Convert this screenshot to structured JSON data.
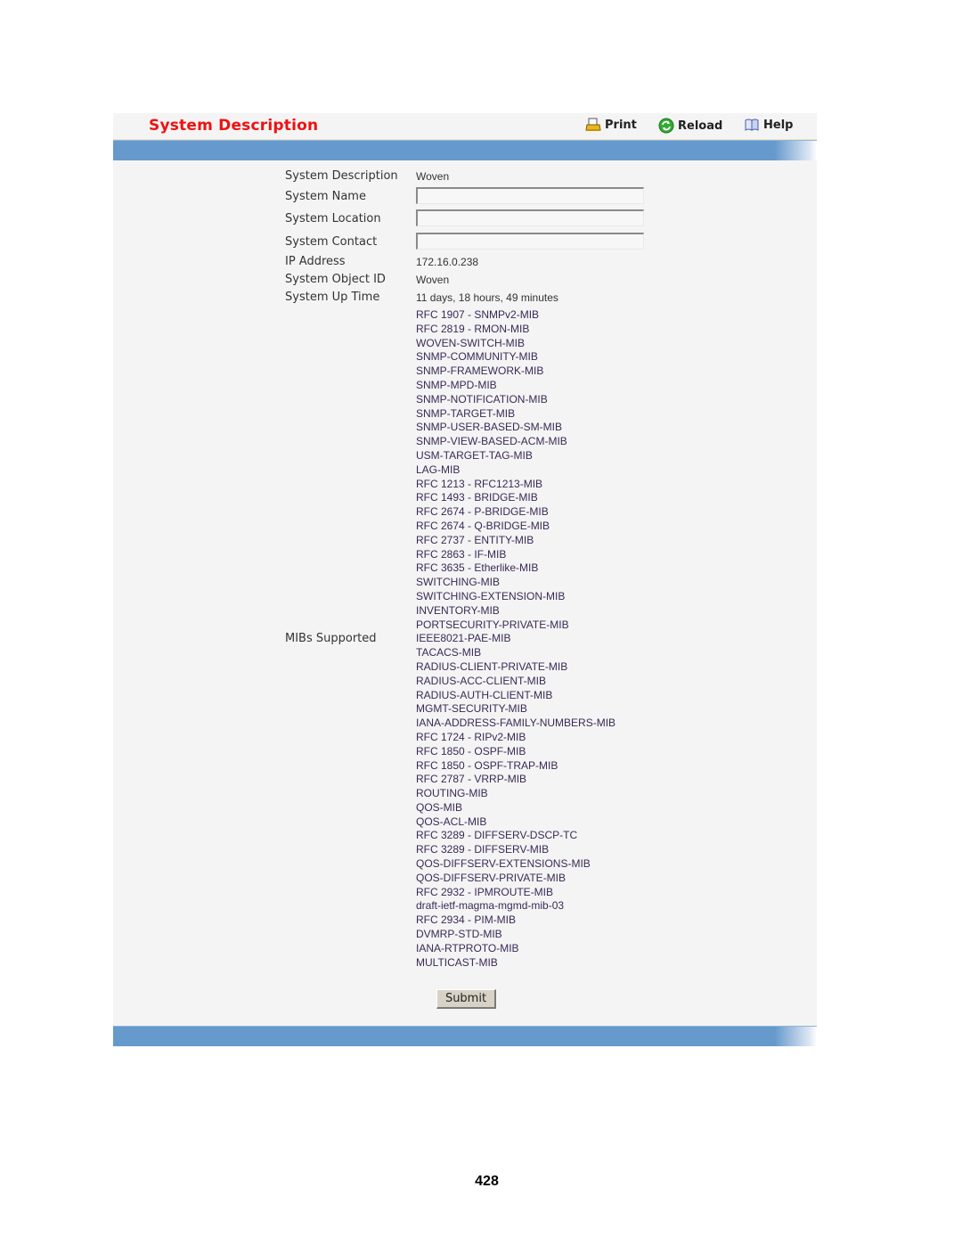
{
  "header": {
    "title": "System Description",
    "toolbar": {
      "print_label": "Print",
      "reload_label": "Reload",
      "help_label": "Help"
    }
  },
  "fields": {
    "system_description": {
      "label": "System Description",
      "value": "Woven"
    },
    "system_name": {
      "label": "System Name",
      "value": ""
    },
    "system_location": {
      "label": "System Location",
      "value": ""
    },
    "system_contact": {
      "label": "System Contact",
      "value": ""
    },
    "ip_address": {
      "label": "IP Address",
      "value": "172.16.0.238"
    },
    "system_object_id": {
      "label": "System Object ID",
      "value": "Woven"
    },
    "system_up_time": {
      "label": "System Up Time",
      "value": "11 days, 18 hours, 49 minutes"
    }
  },
  "mibs": {
    "label": "MIBs Supported",
    "items": [
      "RFC 1907 - SNMPv2-MIB",
      "RFC 2819 - RMON-MIB",
      "WOVEN-SWITCH-MIB",
      "SNMP-COMMUNITY-MIB",
      "SNMP-FRAMEWORK-MIB",
      "SNMP-MPD-MIB",
      "SNMP-NOTIFICATION-MIB",
      "SNMP-TARGET-MIB",
      "SNMP-USER-BASED-SM-MIB",
      "SNMP-VIEW-BASED-ACM-MIB",
      "USM-TARGET-TAG-MIB",
      "LAG-MIB",
      "RFC 1213 - RFC1213-MIB",
      "RFC 1493 - BRIDGE-MIB",
      "RFC 2674 - P-BRIDGE-MIB",
      "RFC 2674 - Q-BRIDGE-MIB",
      "RFC 2737 - ENTITY-MIB",
      "RFC 2863 - IF-MIB",
      "RFC 3635 - Etherlike-MIB",
      "SWITCHING-MIB",
      "SWITCHING-EXTENSION-MIB",
      "INVENTORY-MIB",
      "PORTSECURITY-PRIVATE-MIB",
      "IEEE8021-PAE-MIB",
      "TACACS-MIB",
      "RADIUS-CLIENT-PRIVATE-MIB",
      "RADIUS-ACC-CLIENT-MIB",
      "RADIUS-AUTH-CLIENT-MIB",
      "MGMT-SECURITY-MIB",
      "IANA-ADDRESS-FAMILY-NUMBERS-MIB",
      "RFC 1724 - RIPv2-MIB",
      "RFC 1850 - OSPF-MIB",
      "RFC 1850 - OSPF-TRAP-MIB",
      "RFC 2787 - VRRP-MIB",
      "ROUTING-MIB",
      "QOS-MIB",
      "QOS-ACL-MIB",
      "RFC 3289 - DIFFSERV-DSCP-TC",
      "RFC 3289 - DIFFSERV-MIB",
      "QOS-DIFFSERV-EXTENSIONS-MIB",
      "QOS-DIFFSERV-PRIVATE-MIB",
      "RFC 2932 - IPMROUTE-MIB",
      "draft-ietf-magma-mgmd-mib-03",
      "RFC 2934 - PIM-MIB",
      "DVMRP-STD-MIB",
      "IANA-RTPROTO-MIB",
      "MULTICAST-MIB"
    ]
  },
  "actions": {
    "submit_label": "Submit"
  },
  "footer": {
    "page_number": "428"
  },
  "colors": {
    "title": "#ee1111",
    "bar": "#6699cc",
    "panel": "#f4f4f4",
    "mib_text": "#3a2a55"
  },
  "icons": {
    "print": "printer-icon",
    "reload": "reload-icon",
    "help": "help-book-icon"
  }
}
